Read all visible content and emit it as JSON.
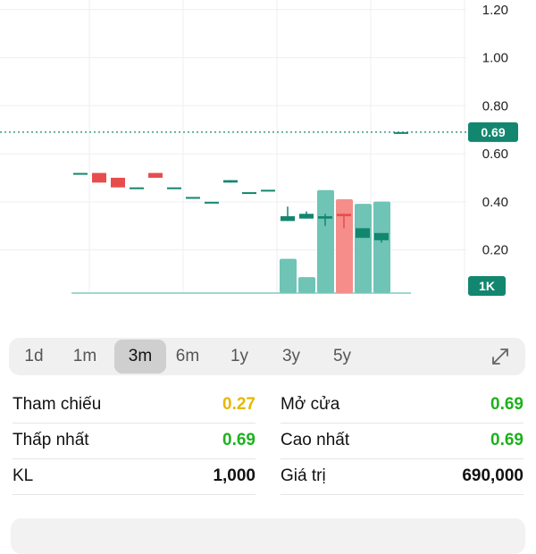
{
  "chart_data": {
    "type": "candlestick",
    "y_ticks": [
      "1.20",
      "1.00",
      "0.80",
      "0.60",
      "0.40",
      "0.20"
    ],
    "y_tick_values": [
      1.2,
      1.0,
      0.8,
      0.6,
      0.4,
      0.2
    ],
    "ylim": [
      0.02,
      1.24
    ],
    "x_ticks": [
      "3",
      "10",
      "17",
      "24"
    ],
    "x_tick_days": [
      3,
      10,
      17,
      24
    ],
    "reference_line": 0.69,
    "price_badge": "0.69",
    "volume_badge": "1K",
    "candles": [
      {
        "day": 1,
        "open": 0.52,
        "close": 0.52,
        "high": 0.52,
        "low": 0.52,
        "dir": "flat"
      },
      {
        "day": 2,
        "open": 0.52,
        "close": 0.48,
        "high": 0.52,
        "low": 0.48,
        "dir": "down"
      },
      {
        "day": 3,
        "open": 0.5,
        "close": 0.46,
        "high": 0.5,
        "low": 0.46,
        "dir": "down"
      },
      {
        "day": 4,
        "open": 0.46,
        "close": 0.46,
        "high": 0.46,
        "low": 0.46,
        "dir": "flat"
      },
      {
        "day": 5,
        "open": 0.52,
        "close": 0.5,
        "high": 0.52,
        "low": 0.5,
        "dir": "down"
      },
      {
        "day": 6,
        "open": 0.46,
        "close": 0.46,
        "high": 0.46,
        "low": 0.46,
        "dir": "flat"
      },
      {
        "day": 7,
        "open": 0.42,
        "close": 0.42,
        "high": 0.42,
        "low": 0.42,
        "dir": "flat"
      },
      {
        "day": 8,
        "open": 0.4,
        "close": 0.4,
        "high": 0.4,
        "low": 0.4,
        "dir": "flat"
      },
      {
        "day": 9,
        "open": 0.49,
        "close": 0.48,
        "high": 0.49,
        "low": 0.48,
        "dir": "up"
      },
      {
        "day": 10,
        "open": 0.44,
        "close": 0.44,
        "high": 0.44,
        "low": 0.44,
        "dir": "flat"
      },
      {
        "day": 11,
        "open": 0.45,
        "close": 0.45,
        "high": 0.45,
        "low": 0.45,
        "dir": "flat"
      },
      {
        "day": 12,
        "open": 0.32,
        "close": 0.34,
        "high": 0.38,
        "low": 0.32,
        "dir": "up"
      },
      {
        "day": 13,
        "open": 0.33,
        "close": 0.35,
        "high": 0.36,
        "low": 0.33,
        "dir": "up"
      },
      {
        "day": 14,
        "open": 0.33,
        "close": 0.34,
        "high": 0.35,
        "low": 0.3,
        "dir": "up"
      },
      {
        "day": 15,
        "open": 0.35,
        "close": 0.34,
        "high": 0.35,
        "low": 0.29,
        "dir": "down"
      },
      {
        "day": 16,
        "open": 0.25,
        "close": 0.29,
        "high": 0.29,
        "low": 0.25,
        "dir": "up"
      },
      {
        "day": 17,
        "open": 0.24,
        "close": 0.27,
        "high": 0.27,
        "low": 0.23,
        "dir": "up"
      },
      {
        "day": 18,
        "open": 0.69,
        "close": 0.69,
        "high": 0.69,
        "low": 0.69,
        "dir": "flat"
      }
    ],
    "volumes": [
      {
        "day": 12,
        "value": 0.3,
        "dir": "up"
      },
      {
        "day": 13,
        "value": 0.14,
        "dir": "up"
      },
      {
        "day": 14,
        "value": 0.9,
        "dir": "up"
      },
      {
        "day": 15,
        "value": 0.82,
        "dir": "down"
      },
      {
        "day": 16,
        "value": 0.78,
        "dir": "up"
      },
      {
        "day": 17,
        "value": 0.8,
        "dir": "up"
      }
    ],
    "colors": {
      "up": "#13866f",
      "down": "#e84d4d",
      "up_vol": "#6fc4b6",
      "down_vol": "#f58d8a",
      "flat": "#13866f"
    }
  },
  "timeframes": [
    "1d",
    "1m",
    "3m",
    "6m",
    "1y",
    "3y",
    "5y"
  ],
  "active_timeframe": "3m",
  "stats": {
    "tham_chieu_label": "Tham chiếu",
    "tham_chieu_value": "0.27",
    "mo_cua_label": "Mở cửa",
    "mo_cua_value": "0.69",
    "thap_nhat_label": "Thấp nhất",
    "thap_nhat_value": "0.69",
    "cao_nhat_label": "Cao nhất",
    "cao_nhat_value": "0.69",
    "kl_label": "KL",
    "kl_value": "1,000",
    "gia_tri_label": "Giá trị",
    "gia_tri_value": "690,000"
  },
  "colors": {
    "reference": "#e6b800",
    "positive": "#1db11d",
    "neutral": "#111111"
  }
}
